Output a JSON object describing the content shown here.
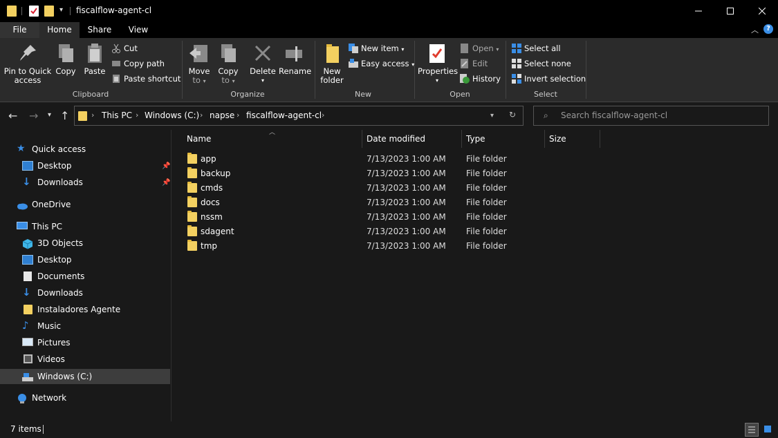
{
  "window": {
    "title": "fiscalflow-agent-cl",
    "minimize_icon": "minimize-icon",
    "maximize_icon": "maximize-icon",
    "close_icon": "close-icon"
  },
  "tabs": [
    {
      "label": "File"
    },
    {
      "label": "Home"
    },
    {
      "label": "Share"
    },
    {
      "label": "View"
    }
  ],
  "ribbon": {
    "clipboard": {
      "group_label": "Clipboard",
      "pin_label_1": "Pin to Quick",
      "pin_label_2": "access",
      "copy_label": "Copy",
      "paste_label": "Paste",
      "cut_label": "Cut",
      "copy_path_label": "Copy path",
      "paste_shortcut_label": "Paste shortcut"
    },
    "organize": {
      "group_label": "Organize",
      "move_label_1": "Move",
      "move_label_2": "to",
      "copy_label_1": "Copy",
      "copy_label_2": "to",
      "delete_label": "Delete",
      "rename_label": "Rename"
    },
    "new": {
      "group_label": "New",
      "new_folder_label_1": "New",
      "new_folder_label_2": "folder",
      "new_item_label": "New item",
      "easy_access_label": "Easy access"
    },
    "open": {
      "group_label": "Open",
      "properties_label": "Properties",
      "open_label": "Open",
      "edit_label": "Edit",
      "history_label": "History"
    },
    "select": {
      "group_label": "Select",
      "select_all_label": "Select all",
      "select_none_label": "Select none",
      "invert_label": "Invert selection"
    }
  },
  "address": {
    "crumbs": [
      "This PC",
      "Windows (C:)",
      "napse",
      "fiscalflow-agent-cl"
    ],
    "search_placeholder": "Search fiscalflow-agent-cl"
  },
  "sidebar": {
    "items": [
      {
        "label": "Quick access",
        "icon": "star-icon"
      },
      {
        "label": "Desktop",
        "icon": "desktop-icon"
      },
      {
        "label": "Downloads",
        "icon": "download-icon"
      },
      {
        "label": "OneDrive",
        "icon": "cloud-icon"
      },
      {
        "label": "This PC",
        "icon": "computer-icon"
      },
      {
        "label": "3D Objects",
        "icon": "cube-icon"
      },
      {
        "label": "Desktop",
        "icon": "desktop-icon"
      },
      {
        "label": "Documents",
        "icon": "document-icon"
      },
      {
        "label": "Downloads",
        "icon": "download-icon"
      },
      {
        "label": "Instaladores Agente",
        "icon": "folder-icon"
      },
      {
        "label": "Music",
        "icon": "music-icon"
      },
      {
        "label": "Pictures",
        "icon": "pictures-icon"
      },
      {
        "label": "Videos",
        "icon": "video-icon"
      },
      {
        "label": "Windows (C:)",
        "icon": "drive-icon"
      },
      {
        "label": "Network",
        "icon": "network-icon"
      }
    ]
  },
  "filelist": {
    "columns": [
      "Name",
      "Date modified",
      "Type",
      "Size"
    ],
    "rows": [
      {
        "name": "app",
        "date": "7/13/2023 1:00 AM",
        "type": "File folder"
      },
      {
        "name": "backup",
        "date": "7/13/2023 1:00 AM",
        "type": "File folder"
      },
      {
        "name": "cmds",
        "date": "7/13/2023 1:00 AM",
        "type": "File folder"
      },
      {
        "name": "docs",
        "date": "7/13/2023 1:00 AM",
        "type": "File folder"
      },
      {
        "name": "nssm",
        "date": "7/13/2023 1:00 AM",
        "type": "File folder"
      },
      {
        "name": "sdagent",
        "date": "7/13/2023 1:00 AM",
        "type": "File folder"
      },
      {
        "name": "tmp",
        "date": "7/13/2023 1:00 AM",
        "type": "File folder"
      }
    ]
  },
  "status": {
    "item_count": "7 items"
  },
  "colors": {
    "background": "#191919",
    "ribbon": "#2b2b2b",
    "titlebar": "#000000",
    "folder": "#f3d060",
    "accent_blue": "#3a8ee6"
  }
}
